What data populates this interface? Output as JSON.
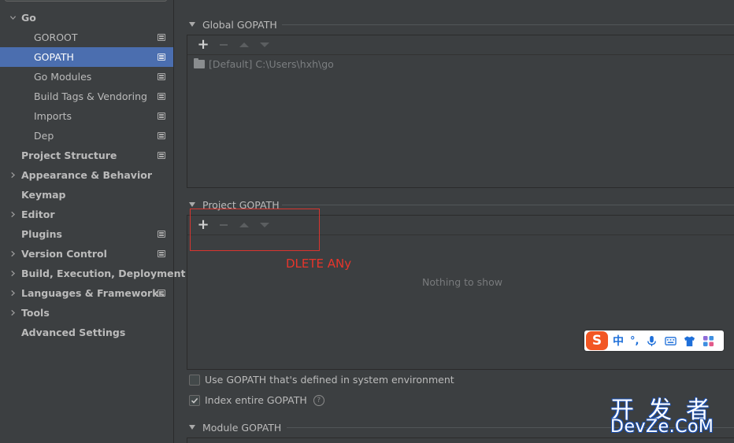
{
  "sidebar": {
    "items": [
      {
        "label": "Go",
        "level": 0,
        "bold": true,
        "chevron": "down",
        "icon": false,
        "selected": false
      },
      {
        "label": "GOROOT",
        "level": 1,
        "bold": false,
        "chevron": "",
        "icon": true,
        "selected": false
      },
      {
        "label": "GOPATH",
        "level": 1,
        "bold": false,
        "chevron": "",
        "icon": true,
        "selected": true
      },
      {
        "label": "Go Modules",
        "level": 1,
        "bold": false,
        "chevron": "",
        "icon": true,
        "selected": false
      },
      {
        "label": "Build Tags & Vendoring",
        "level": 1,
        "bold": false,
        "chevron": "",
        "icon": true,
        "selected": false
      },
      {
        "label": "Imports",
        "level": 1,
        "bold": false,
        "chevron": "",
        "icon": true,
        "selected": false
      },
      {
        "label": "Dep",
        "level": 1,
        "bold": false,
        "chevron": "",
        "icon": true,
        "selected": false
      },
      {
        "label": "Project Structure",
        "level": 0,
        "bold": true,
        "chevron": "",
        "icon": true,
        "selected": false
      },
      {
        "label": "Appearance & Behavior",
        "level": 0,
        "bold": true,
        "chevron": "right",
        "icon": false,
        "selected": false
      },
      {
        "label": "Keymap",
        "level": 0,
        "bold": true,
        "chevron": "",
        "icon": false,
        "selected": false
      },
      {
        "label": "Editor",
        "level": 0,
        "bold": true,
        "chevron": "right",
        "icon": false,
        "selected": false
      },
      {
        "label": "Plugins",
        "level": 0,
        "bold": true,
        "chevron": "",
        "icon": true,
        "selected": false
      },
      {
        "label": "Version Control",
        "level": 0,
        "bold": true,
        "chevron": "right",
        "icon": true,
        "selected": false
      },
      {
        "label": "Build, Execution, Deployment",
        "level": 0,
        "bold": true,
        "chevron": "right",
        "icon": false,
        "selected": false
      },
      {
        "label": "Languages & Frameworks",
        "level": 0,
        "bold": true,
        "chevron": "right",
        "icon": true,
        "selected": false
      },
      {
        "label": "Tools",
        "level": 0,
        "bold": true,
        "chevron": "right",
        "icon": false,
        "selected": false
      },
      {
        "label": "Advanced Settings",
        "level": 0,
        "bold": true,
        "chevron": "",
        "icon": false,
        "selected": false
      }
    ]
  },
  "global_gopath": {
    "title": "Global GOPATH",
    "toolbar": {
      "add": "+"
    },
    "entry": "[Default] C:\\Users\\hxh\\go"
  },
  "project_gopath": {
    "title": "Project GOPATH",
    "toolbar": {
      "add": "+"
    },
    "empty_text": "Nothing to show"
  },
  "annotation": {
    "text": "DLETE ANy",
    "color": "#e8352b"
  },
  "options": {
    "use_system_gopath": {
      "label": "Use GOPATH that's defined in system environment",
      "checked": false
    },
    "index_entire_gopath": {
      "label": "Index entire GOPATH",
      "checked": true,
      "help": "?"
    }
  },
  "module_gopath": {
    "title": "Module GOPATH"
  },
  "ime": {
    "logo": "S",
    "mode": "中",
    "punct": "°,"
  },
  "watermark": {
    "cn": "开发者",
    "en": "DevZe.CoM"
  },
  "colors": {
    "background": "#3c3f41",
    "selection": "#4b6eaf",
    "text": "#bbbbbb",
    "annotation": "#d9352f",
    "ime_logo": "#f25623",
    "ime_blue": "#1e6fd9"
  }
}
